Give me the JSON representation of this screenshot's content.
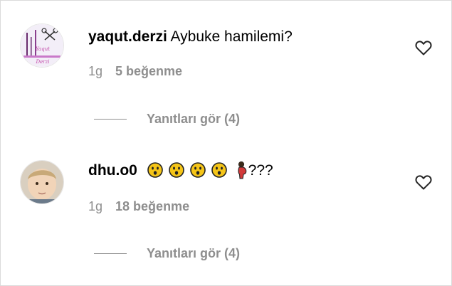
{
  "comments": [
    {
      "username": "yaqut.derzi",
      "text": "Aybuke hamilemi?",
      "time": "1g",
      "likes": "5 beğenme",
      "replies": "Yanıtları gör (4)",
      "avatar_text": "Yaqut Derzi",
      "like_icon": "heart-outline-icon"
    },
    {
      "username": "dhu.o0",
      "text_suffix": "???",
      "emojis": [
        "hushed-face-emoji",
        "hushed-face-emoji",
        "hushed-face-emoji",
        "hushed-face-emoji",
        "pregnant-woman-emoji"
      ],
      "time": "1g",
      "likes": "18 beğenme",
      "replies": "Yanıtları gör (4)",
      "like_icon": "heart-outline-icon"
    }
  ],
  "colors": {
    "muted": "#8e8e8e",
    "divider": "#dbdbdb",
    "emoji": "#f5c518"
  }
}
